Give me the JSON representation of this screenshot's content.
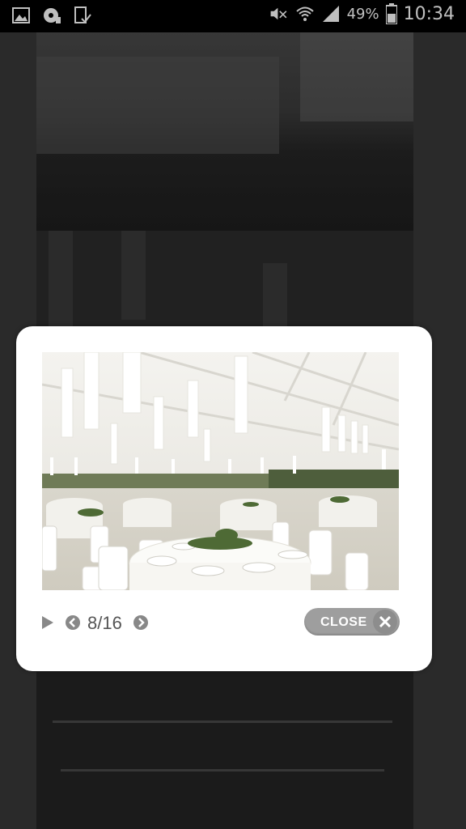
{
  "status_bar": {
    "battery_percent": "49%",
    "clock": "10:34",
    "left_icons": [
      "gallery-icon",
      "disc-icon",
      "clipboard-check-icon"
    ],
    "right_icons": [
      "mute-icon",
      "wifi-icon",
      "signal-icon",
      "battery-icon"
    ]
  },
  "lightbox": {
    "counter": "8/16",
    "close_label": "CLOSE",
    "current_index": 8,
    "total": 16
  }
}
